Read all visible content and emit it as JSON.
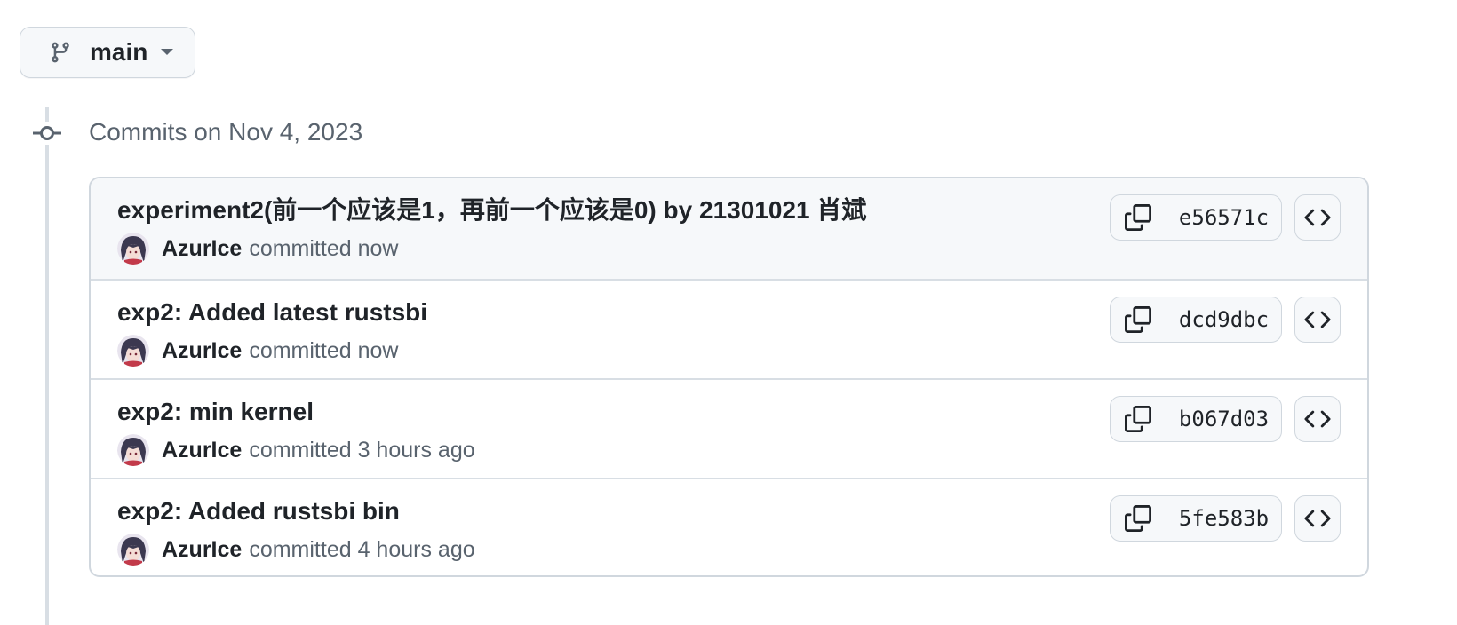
{
  "branch": {
    "name": "main",
    "icon": "git-branch-icon"
  },
  "timeline": {
    "heading": "Commits on Nov 4, 2023",
    "node_icon": "git-commit-icon"
  },
  "commits": [
    {
      "title": "experiment2(前一个应该是1，再前一个应该是0) by 21301021 肖斌",
      "author": "AzurIce",
      "action": "committed",
      "time": "now",
      "sha": "e56571c"
    },
    {
      "title": "exp2: Added latest rustsbi",
      "author": "AzurIce",
      "action": "committed",
      "time": "now",
      "sha": "dcd9dbc"
    },
    {
      "title": "exp2: min kernel",
      "author": "AzurIce",
      "action": "committed",
      "time": "3 hours ago",
      "sha": "b067d03"
    },
    {
      "title": "exp2: Added rustsbi bin",
      "author": "AzurIce",
      "action": "committed",
      "time": "4 hours ago",
      "sha": "5fe583b"
    }
  ],
  "icons": {
    "copy": "copy-icon",
    "browse": "code-icon",
    "caret": "triangle-down-icon"
  },
  "colors": {
    "text": "#1f2328",
    "muted": "#59636e",
    "border": "#d0d7de",
    "button_bg": "#f6f8fa"
  }
}
